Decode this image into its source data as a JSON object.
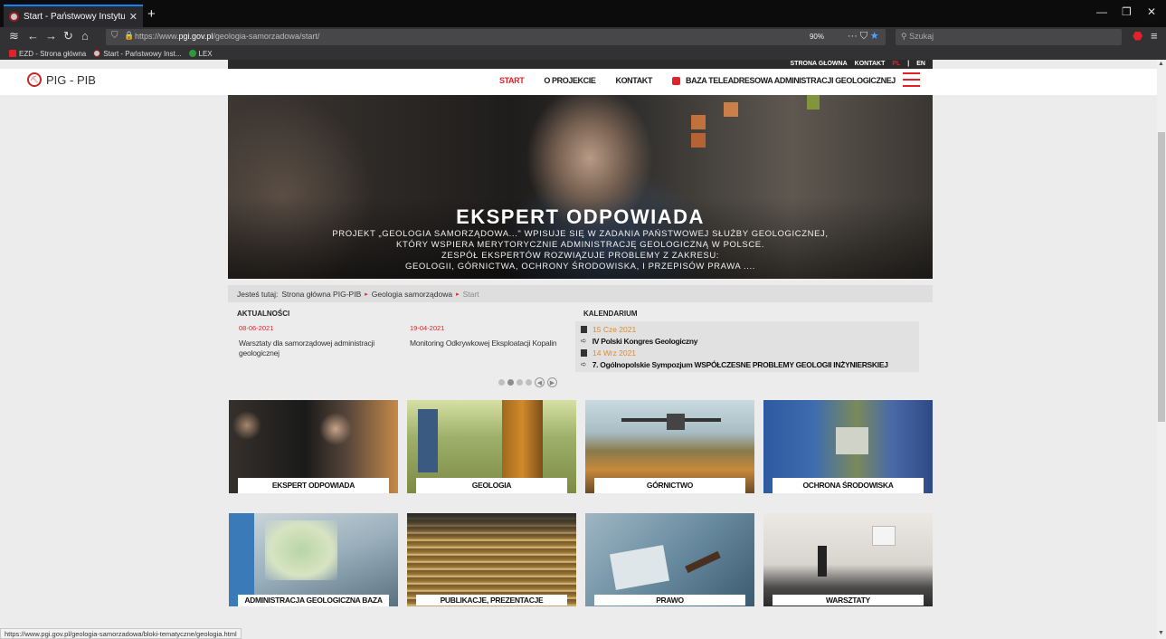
{
  "browser": {
    "tab_title": "Start - Państwowy Instytut Geo",
    "url_prefix": "https://www.",
    "url_domain": "pgi.gov.pl",
    "url_path": "/geologia-samorzadowa/start/",
    "zoom": "90%",
    "search_placeholder": "Szukaj",
    "bookmarks": [
      {
        "label": "EZD - Strona główna"
      },
      {
        "label": "Start - Państwowy Inst..."
      },
      {
        "label": "LEX"
      }
    ]
  },
  "site": {
    "top_links": [
      "STRONA GŁÓWNA",
      "KONTAKT"
    ],
    "lang_pl": "PL",
    "lang_sep": "|",
    "lang_en": "EN",
    "logo_text": "PIG - PIB",
    "nav": {
      "start": "START",
      "project": "O PROJEKCIE",
      "contact": "KONTAKT",
      "database": "BAZA TELEADRESOWA ADMINISTRACJI GEOLOGICZNEJ"
    }
  },
  "hero": {
    "title": "EKSPERT ODPOWIADA",
    "lines": [
      "PROJEKT „GEOLOGIA SAMORZĄDOWA...\" WPISUJE SIĘ W ZADANIA PAŃSTWOWEJ SŁUŻBY GEOLOGICZNEJ,",
      "KTÓRY WSPIERA MERYTORYCZNIE ADMINISTRACJĘ GEOLOGICZNĄ W POLSCE.",
      "ZESPÓŁ EKSPERTÓW ROZWIĄZUJE PROBLEMY Z ZAKRESU:",
      "GEOLOGII, GÓRNICTWA, OCHRONY ŚRODOWISKA, I PRZEPISÓW PRAWA ...."
    ]
  },
  "breadcrumb": {
    "prefix": "Jesteś tutaj:",
    "items": [
      "Strona główna PIG-PIB",
      "Geologia samorządowa"
    ],
    "current": "Start"
  },
  "news": {
    "heading": "AKTUALNOŚCI",
    "items": [
      {
        "date": "08-06-2021",
        "title": "Warsztaty dla samorządowej administracji geologicznej"
      },
      {
        "date": "19-04-2021",
        "title": "Monitoring Odkrywkowej Eksploatacji Kopalin"
      }
    ]
  },
  "calendar": {
    "heading": "KALENDARIUM",
    "events": [
      {
        "date": "15 Cze 2021",
        "title": "IV Polski Kongres Geologiczny"
      },
      {
        "date": "14 Wrz 2021",
        "title": "7. Ogólnopolskie Sympozjum WSPÓŁCZESNE PROBLEMY GEOLOGII INŻYNIERSKIEJ"
      }
    ]
  },
  "tiles": {
    "row1": [
      "EKSPERT ODPOWIADA",
      "GEOLOGIA",
      "GÓRNICTWO",
      "OCHRONA ŚRODOWISKA"
    ],
    "row2": [
      "ADMINISTRACJA GEOLOGICZNA BAZA TELEADRESOWA",
      "PUBLIKACJE, PREZENTACJE",
      "PRAWO",
      "WARSZTATY"
    ]
  },
  "status": {
    "url": "https://www.pgi.gov.pl/geologia-samorzadowa/bloki-tematyczne/geologia.html"
  },
  "colors": {
    "accent": "#e2222a",
    "calendar_date": "#e28a2a"
  }
}
